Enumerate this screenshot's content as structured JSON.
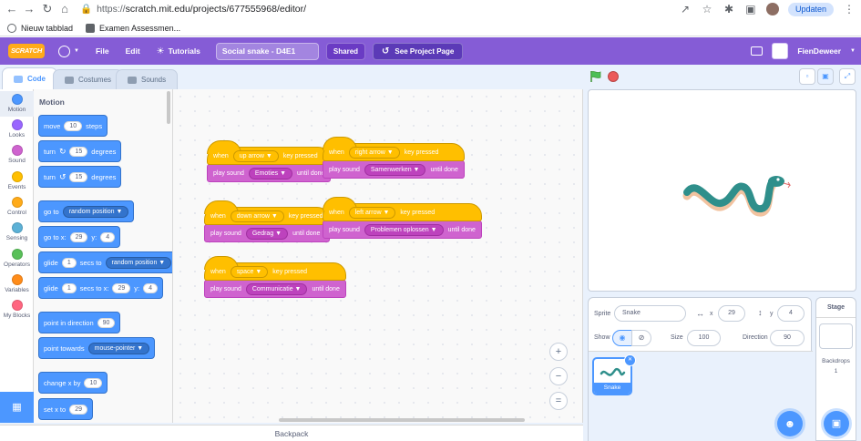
{
  "browser": {
    "back_icon": "arrow-left-icon",
    "forward_icon": "arrow-right-icon",
    "reload_icon": "reload-icon",
    "home_icon": "home-icon",
    "url_scheme": "https://",
    "url_rest": "scratch.mit.edu/projects/677555968/editor/",
    "update_label": "Updaten",
    "bookmarks": [
      {
        "label": "Nieuw tabblad"
      },
      {
        "label": "Examen Assessmen..."
      }
    ]
  },
  "menu": {
    "logo": "SCRATCH",
    "file": "File",
    "edit": "Edit",
    "tutorials": "Tutorials",
    "project_title": "Social snake - D4E1",
    "shared": "Shared",
    "see_project": "See Project Page",
    "username": "FienDeweer",
    "accent": "#855cd6"
  },
  "tabs": {
    "code": "Code",
    "costumes": "Costumes",
    "sounds": "Sounds"
  },
  "categories": [
    {
      "label": "Motion",
      "color": "#4c97ff"
    },
    {
      "label": "Looks",
      "color": "#9966ff"
    },
    {
      "label": "Sound",
      "color": "#cf63cf"
    },
    {
      "label": "Events",
      "color": "#ffbf00"
    },
    {
      "label": "Control",
      "color": "#ffab19"
    },
    {
      "label": "Sensing",
      "color": "#5cb1d6"
    },
    {
      "label": "Operators",
      "color": "#59c059"
    },
    {
      "label": "Variables",
      "color": "#ff8c1a"
    },
    {
      "label": "My Blocks",
      "color": "#ff6680"
    }
  ],
  "palette": {
    "title": "Motion",
    "move": {
      "a": "move",
      "v": "10",
      "b": "steps"
    },
    "turn_right": {
      "a": "turn",
      "v": "15",
      "b": "degrees"
    },
    "turn_left": {
      "a": "turn",
      "v": "15",
      "b": "degrees"
    },
    "goto": {
      "a": "go to",
      "dd": "random position"
    },
    "goto_xy": {
      "a": "go to x:",
      "x": "29",
      "b": "y:",
      "y": "4"
    },
    "glide_to": {
      "a": "glide",
      "v": "1",
      "b": "secs to",
      "dd": "random position"
    },
    "glide_xy": {
      "a": "glide",
      "v": "1",
      "b": "secs to x:",
      "x": "29",
      "c": "y:",
      "y": "4"
    },
    "point_dir": {
      "a": "point in direction",
      "v": "90"
    },
    "point_towards": {
      "a": "point towards",
      "dd": "mouse-pointer"
    },
    "change_x": {
      "a": "change x by",
      "v": "10"
    },
    "set_x": {
      "a": "set x to",
      "v": "29"
    }
  },
  "scripts": [
    {
      "when": "when",
      "key": "up arrow",
      "pressed": "key pressed",
      "play": "play sound",
      "sound": "Emoties",
      "until": "until done"
    },
    {
      "when": "when",
      "key": "right arrow",
      "pressed": "key pressed",
      "play": "play sound",
      "sound": "Samenwerken",
      "until": "until done"
    },
    {
      "when": "when",
      "key": "down arrow",
      "pressed": "key pressed",
      "play": "play sound",
      "sound": "Gedrag",
      "until": "until done"
    },
    {
      "when": "when",
      "key": "left arrow",
      "pressed": "key pressed",
      "play": "play sound",
      "sound": "Problemen oplossen",
      "until": "until done"
    },
    {
      "when": "when",
      "key": "space",
      "pressed": "key pressed",
      "play": "play sound",
      "sound": "Communicatie",
      "until": "until done"
    }
  ],
  "backpack": "Backpack",
  "sprite_info": {
    "sprite_label": "Sprite",
    "sprite_name": "Snake",
    "x_label": "x",
    "x_value": "29",
    "y_label": "y",
    "y_value": "4",
    "show_label": "Show",
    "size_label": "Size",
    "size_value": "100",
    "direction_label": "Direction",
    "direction_value": "90"
  },
  "sprites": [
    {
      "name": "Snake"
    }
  ],
  "stage_panel": {
    "title": "Stage",
    "backdrops_label": "Backdrops",
    "backdrops_count": "1"
  }
}
